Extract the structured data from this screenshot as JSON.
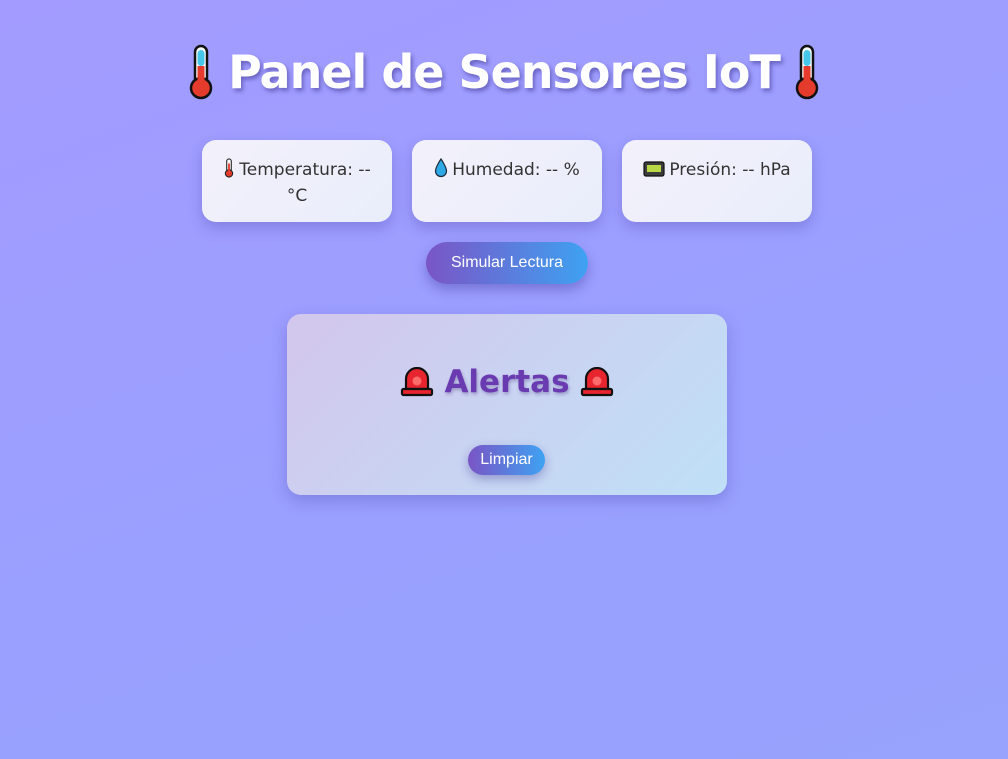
{
  "header": {
    "title": "Panel de Sensores IoT",
    "icon_left": "thermometer-icon",
    "icon_right": "thermometer-icon"
  },
  "sensors": [
    {
      "icon": "thermometer-icon",
      "text": "Temperatura: -- °C"
    },
    {
      "icon": "droplet-icon",
      "text": "Humedad: -- %"
    },
    {
      "icon": "pager-icon",
      "text": "Presión: -- hPa"
    }
  ],
  "actions": {
    "simulate_label": "Simular Lectura"
  },
  "alerts": {
    "title": "Alertas",
    "icon": "siren-icon",
    "clear_label": "Limpiar"
  },
  "colors": {
    "background": "#9d9dff",
    "button_gradient_start": "#7a55c6",
    "button_gradient_end": "#3ea2f2",
    "alerts_title": "#6a3ab0"
  }
}
